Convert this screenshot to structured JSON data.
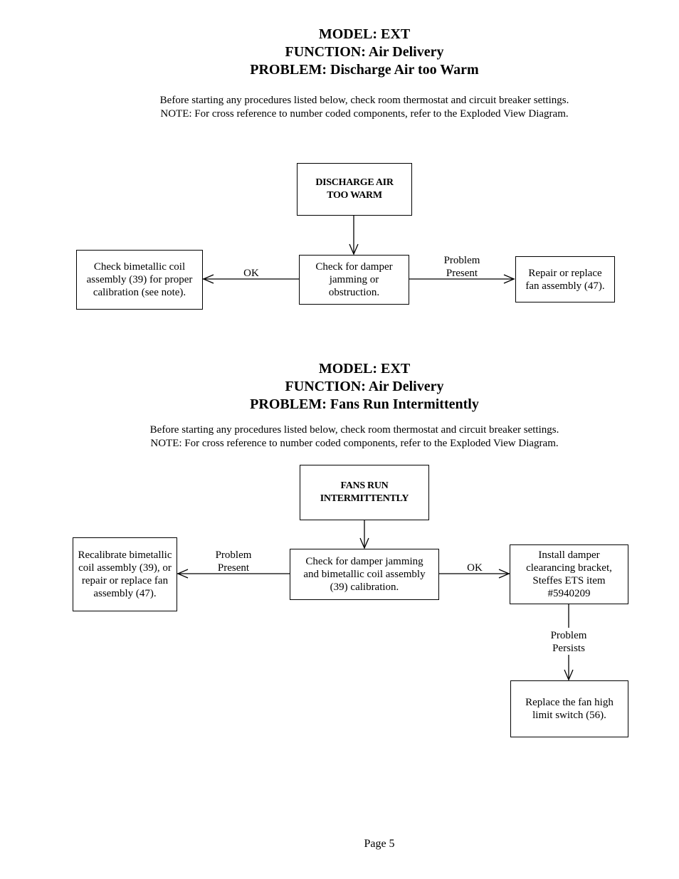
{
  "section1": {
    "model": "MODEL:  EXT",
    "function": "FUNCTION:  Air Delivery",
    "problem": "PROBLEM:  Discharge Air too Warm",
    "note1": "Before starting any procedures listed below, check room thermostat and circuit breaker settings.",
    "note2": "NOTE:  For cross reference to number coded components, refer to the Exploded View Diagram.",
    "start": "DISCHARGE AIR TOO WARM",
    "check": "Check for damper jamming or obstruction.",
    "left_box": "Check bimetallic coil assembly (39) for proper calibration (see note).",
    "right_box": "Repair or replace fan assembly (47).",
    "left_label": "OK",
    "right_label_1": "Problem",
    "right_label_2": "Present"
  },
  "section2": {
    "model": "MODEL:  EXT",
    "function": "FUNCTION:  Air Delivery",
    "problem": "PROBLEM:  Fans Run Intermittently",
    "note1": "Before starting any procedures listed below, check room thermostat and circuit breaker settings.",
    "note2": "NOTE:  For cross reference to number coded components, refer to the Exploded View Diagram.",
    "start": "FANS RUN INTERMITTENTLY",
    "check": "Check for damper jamming and bimetallic coil assembly (39) calibration.",
    "left_box": "Recalibrate bimetallic coil assembly (39), or repair or replace fan assembly (47).",
    "right_box": "Install damper clearancing bracket, Steffes ETS item #5940209",
    "bottom_box": "Replace the fan high limit switch (56).",
    "left_label_1": "Problem",
    "left_label_2": "Present",
    "right_label": "OK",
    "down_label_1": "Problem",
    "down_label_2": "Persists"
  },
  "footer": {
    "page": "Page 5"
  }
}
